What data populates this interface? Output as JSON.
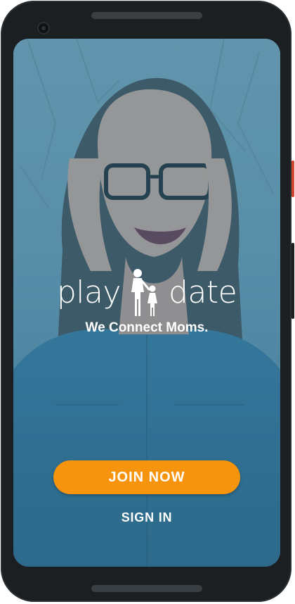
{
  "app": {
    "logo_left": "play",
    "logo_right": "date",
    "tagline": "We Connect Moms."
  },
  "actions": {
    "join_label": "JOIN NOW",
    "signin_label": "SIGN IN"
  },
  "colors": {
    "accent": "#f7940d",
    "overlay": "#4088aa",
    "text": "#ffffff"
  },
  "icons": {
    "logo_mark": "mother-and-child-icon"
  }
}
